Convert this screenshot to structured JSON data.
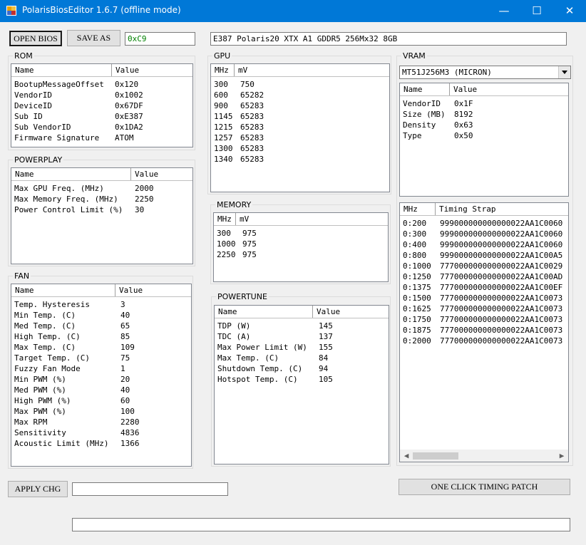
{
  "window": {
    "title": "PolarisBiosEditor 1.6.7 (offline mode)",
    "minimize": "—",
    "maximize": "☐",
    "close": "✕"
  },
  "toolbar": {
    "open_bios": "OPEN BIOS",
    "save_as": "SAVE AS",
    "checksum": "0xC9",
    "bios_info": "E387 Polaris20 XTX A1 GDDR5 256Mx32 8GB"
  },
  "rom": {
    "legend": "ROM",
    "headers": [
      "Name",
      "Value"
    ],
    "rows": [
      [
        "BootupMessageOffset",
        "0x120"
      ],
      [
        "VendorID",
        "0x1002"
      ],
      [
        "DeviceID",
        "0x67DF"
      ],
      [
        "Sub ID",
        "0xE387"
      ],
      [
        "Sub VendorID",
        "0x1DA2"
      ],
      [
        "Firmware Signature",
        "ATOM"
      ]
    ]
  },
  "powerplay": {
    "legend": "POWERPLAY",
    "headers": [
      "Name",
      "Value"
    ],
    "rows": [
      [
        "Max GPU Freq. (MHz)",
        "2000"
      ],
      [
        "Max Memory Freq. (MHz)",
        "2250"
      ],
      [
        "Power Control Limit (%)",
        "30"
      ]
    ]
  },
  "fan": {
    "legend": "FAN",
    "headers": [
      "Name",
      "Value"
    ],
    "rows": [
      [
        "Temp. Hysteresis",
        "3"
      ],
      [
        "Min Temp. (C)",
        "40"
      ],
      [
        "Med Temp. (C)",
        "65"
      ],
      [
        "High Temp. (C)",
        "85"
      ],
      [
        "Max Temp. (C)",
        "109"
      ],
      [
        "Target Temp. (C)",
        "75"
      ],
      [
        "Fuzzy Fan Mode",
        "1"
      ],
      [
        "Min PWM (%)",
        "20"
      ],
      [
        "Med PWM (%)",
        "40"
      ],
      [
        "High PWM (%)",
        "60"
      ],
      [
        "Max PWM (%)",
        "100"
      ],
      [
        "Max RPM",
        "2280"
      ],
      [
        "Sensitivity",
        "4836"
      ],
      [
        "Acoustic Limit (MHz)",
        "1366"
      ]
    ]
  },
  "gpu": {
    "legend": "GPU",
    "headers": [
      "MHz",
      "mV"
    ],
    "rows": [
      [
        "300",
        "750"
      ],
      [
        "600",
        "65282"
      ],
      [
        "900",
        "65283"
      ],
      [
        "1145",
        "65283"
      ],
      [
        "1215",
        "65283"
      ],
      [
        "1257",
        "65283"
      ],
      [
        "1300",
        "65283"
      ],
      [
        "1340",
        "65283"
      ]
    ]
  },
  "memory": {
    "legend": "MEMORY",
    "headers": [
      "MHz",
      "mV"
    ],
    "rows": [
      [
        "300",
        "975"
      ],
      [
        "1000",
        "975"
      ],
      [
        "2250",
        "975"
      ]
    ]
  },
  "powertune": {
    "legend": "POWERTUNE",
    "headers": [
      "Name",
      "Value"
    ],
    "rows": [
      [
        "TDP (W)",
        "145"
      ],
      [
        "TDC (A)",
        "137"
      ],
      [
        "Max Power Limit (W)",
        "155"
      ],
      [
        "Max Temp. (C)",
        "84"
      ],
      [
        "Shutdown Temp. (C)",
        "94"
      ],
      [
        "Hotspot Temp. (C)",
        "105"
      ]
    ]
  },
  "vram": {
    "legend": "VRAM",
    "selected": "MT51J256M3 (MICRON)",
    "headers": [
      "Name",
      "Value"
    ],
    "rows": [
      [
        "VendorID",
        "0x1F"
      ],
      [
        "Size (MB)",
        "8192"
      ],
      [
        "Density",
        "0x63"
      ],
      [
        "Type",
        "0x50"
      ]
    ]
  },
  "timing": {
    "headers": [
      "MHz",
      "Timing Strap"
    ],
    "rows": [
      [
        "0:200",
        "999000000000000022AA1C0060"
      ],
      [
        "0:300",
        "999000000000000022AA1C0060"
      ],
      [
        "0:400",
        "999000000000000022AA1C0060"
      ],
      [
        "0:800",
        "999000000000000022AA1C00A5"
      ],
      [
        "0:1000",
        "777000000000000022AA1C0029"
      ],
      [
        "0:1250",
        "777000000000000022AA1C00AD"
      ],
      [
        "0:1375",
        "777000000000000022AA1C00EF"
      ],
      [
        "0:1500",
        "777000000000000022AA1C0073"
      ],
      [
        "0:1625",
        "777000000000000022AA1C0073"
      ],
      [
        "0:1750",
        "777000000000000022AA1C0073"
      ],
      [
        "0:1875",
        "777000000000000022AA1C0073"
      ],
      [
        "0:2000",
        "777000000000000022AA1C0073"
      ]
    ]
  },
  "footer": {
    "apply": "APPLY CHG",
    "apply_text": "",
    "timing_patch": "ONE CLICK TIMING PATCH",
    "status": ""
  },
  "colors": {
    "titlebar": "#0078d7",
    "checksum_text": "#008000"
  }
}
